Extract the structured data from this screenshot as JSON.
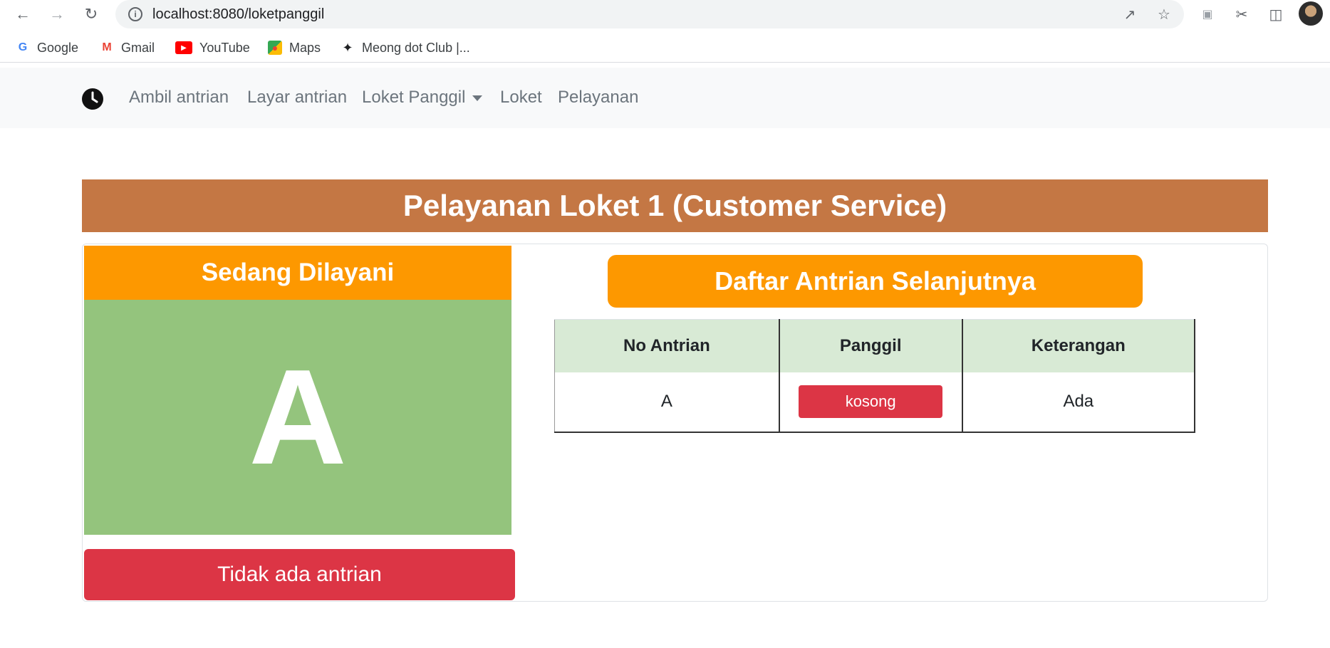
{
  "browser": {
    "url": "localhost:8080/loketpanggil",
    "bookmarks": [
      {
        "label": "Google",
        "icon": "google-icon"
      },
      {
        "label": "Gmail",
        "icon": "gmail-icon"
      },
      {
        "label": "YouTube",
        "icon": "youtube-icon"
      },
      {
        "label": "Maps",
        "icon": "maps-icon"
      },
      {
        "label": "Meong dot Club |...",
        "icon": "cat-icon"
      }
    ]
  },
  "navbar": {
    "brand_icon": "clock-icon",
    "links": [
      "Ambil antrian",
      "Layar antrian",
      "Loket Panggil",
      "Loket",
      "Pelayanan"
    ]
  },
  "main": {
    "title": "Pelayanan Loket 1 (Customer Service)",
    "serving": {
      "heading": "Sedang Dilayani",
      "current": "A",
      "status_button": "Tidak ada antrian"
    },
    "next_queue": {
      "heading": "Daftar Antrian Selanjutnya",
      "columns": [
        "No Antrian",
        "Panggil",
        "Keterangan"
      ],
      "rows": [
        {
          "no": "A",
          "call_label": "kosong",
          "note": "Ada"
        }
      ]
    }
  },
  "colors": {
    "title_bar": "#c47744",
    "orange": "#fd9800",
    "green": "#94c47d",
    "danger": "#dc3545",
    "table_head": "#d8ead5"
  }
}
